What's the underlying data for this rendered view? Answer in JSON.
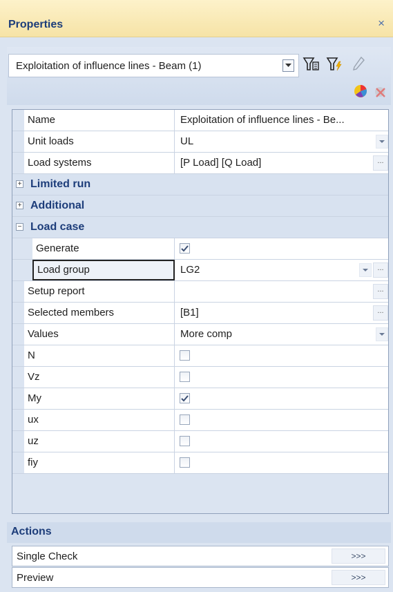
{
  "panel": {
    "title": "Properties",
    "close_glyph": "×"
  },
  "toolbar": {
    "selector_value": "Exploitation of influence lines - Beam (1)",
    "icons": [
      "filter-icon",
      "filter-flash-icon",
      "pencil-icon",
      "pie-chart-icon",
      "delete-chart-icon"
    ]
  },
  "props": [
    {
      "name": "Name",
      "value": "Exploitation of influence lines - Be...",
      "control": "text"
    },
    {
      "name": "Unit loads",
      "value": "UL",
      "control": "dropdown"
    },
    {
      "name": "Load systems",
      "value": "[P Load] [Q Load]",
      "control": "ellipsis"
    }
  ],
  "categories": {
    "limited_run": {
      "label": "Limited run",
      "expander": "+"
    },
    "additional": {
      "label": "Additional",
      "expander": "+"
    },
    "load_case": {
      "label": "Load case",
      "expander": "−"
    }
  },
  "load_case": {
    "generate": {
      "name": "Generate",
      "checked": true
    },
    "load_group": {
      "name": "Load group",
      "value": "LG2"
    }
  },
  "props2": [
    {
      "name": "Setup report",
      "value": ""
    },
    {
      "name": "Selected members",
      "value": "[B1]"
    },
    {
      "name": "Values",
      "value": "More comp"
    }
  ],
  "checks": [
    {
      "name": "N",
      "checked": false
    },
    {
      "name": "Vz",
      "checked": false
    },
    {
      "name": "My",
      "checked": true
    },
    {
      "name": "ux",
      "checked": false
    },
    {
      "name": "uz",
      "checked": false
    },
    {
      "name": "fiy",
      "checked": false
    }
  ],
  "actions": {
    "header": "Actions",
    "items": [
      {
        "label": "Single Check",
        "button": ">>>"
      },
      {
        "label": "Preview",
        "button": ">>>"
      }
    ]
  },
  "colors": {
    "header_text": "#1d3d7a",
    "title_bar": "#f6e3a6",
    "panel_bg": "#dbe4f1"
  }
}
